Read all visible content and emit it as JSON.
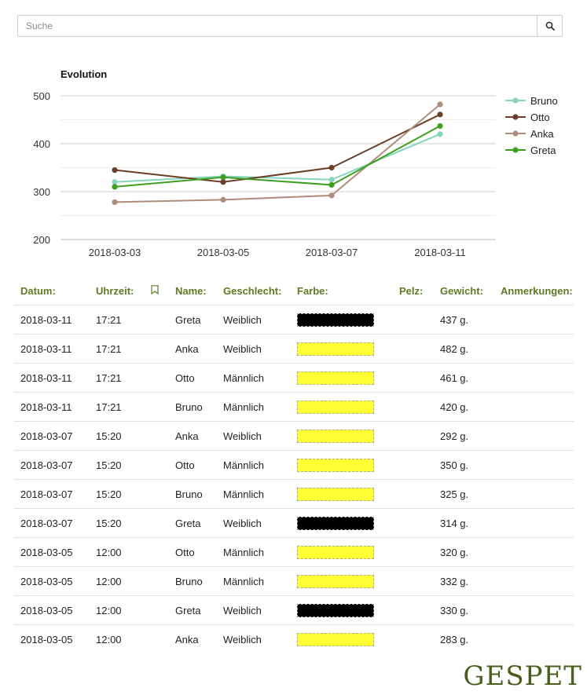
{
  "search": {
    "placeholder": "Suche"
  },
  "chart_data": {
    "type": "line",
    "title": "Evolution",
    "categories": [
      "2018-03-03",
      "2018-03-05",
      "2018-03-07",
      "2018-03-11"
    ],
    "ylim": [
      200,
      500
    ],
    "yticks": [
      200,
      300,
      400,
      500
    ],
    "grid": true,
    "legend": "right",
    "series": [
      {
        "name": "Bruno",
        "color": "#86d6bc",
        "values": [
          320,
          332,
          325,
          420
        ]
      },
      {
        "name": "Otto",
        "color": "#6b3e26",
        "values": [
          345,
          320,
          350,
          461
        ]
      },
      {
        "name": "Anka",
        "color": "#b08d7a",
        "values": [
          278,
          283,
          292,
          482
        ]
      },
      {
        "name": "Greta",
        "color": "#3f9e1f",
        "values": [
          310,
          330,
          314,
          437
        ]
      }
    ]
  },
  "table": {
    "headers": {
      "date": "Datum:",
      "time": "Uhrzeit:",
      "name": "Name:",
      "sex": "Geschlecht:",
      "color": "Farbe:",
      "fur": "Pelz:",
      "weight": "Gewicht:",
      "notes": "Anmerkungen:"
    },
    "rows": [
      {
        "date": "2018-03-11",
        "time": "17:21",
        "name": "Greta",
        "sex": "Weiblich",
        "color": "#000000",
        "fur": "",
        "weight": "437 g.",
        "notes": ""
      },
      {
        "date": "2018-03-11",
        "time": "17:21",
        "name": "Anka",
        "sex": "Weiblich",
        "color": "#ffff33",
        "fur": "",
        "weight": "482 g.",
        "notes": ""
      },
      {
        "date": "2018-03-11",
        "time": "17:21",
        "name": "Otto",
        "sex": "Männlich",
        "color": "#ffff33",
        "fur": "",
        "weight": "461 g.",
        "notes": ""
      },
      {
        "date": "2018-03-11",
        "time": "17:21",
        "name": "Bruno",
        "sex": "Männlich",
        "color": "#ffff33",
        "fur": "",
        "weight": "420 g.",
        "notes": ""
      },
      {
        "date": "2018-03-07",
        "time": "15:20",
        "name": "Anka",
        "sex": "Weiblich",
        "color": "#ffff33",
        "fur": "",
        "weight": "292 g.",
        "notes": ""
      },
      {
        "date": "2018-03-07",
        "time": "15:20",
        "name": "Otto",
        "sex": "Männlich",
        "color": "#ffff33",
        "fur": "",
        "weight": "350 g.",
        "notes": ""
      },
      {
        "date": "2018-03-07",
        "time": "15:20",
        "name": "Bruno",
        "sex": "Männlich",
        "color": "#ffff33",
        "fur": "",
        "weight": "325 g.",
        "notes": ""
      },
      {
        "date": "2018-03-07",
        "time": "15:20",
        "name": "Greta",
        "sex": "Weiblich",
        "color": "#000000",
        "fur": "",
        "weight": "314 g.",
        "notes": ""
      },
      {
        "date": "2018-03-05",
        "time": "12:00",
        "name": "Otto",
        "sex": "Männlich",
        "color": "#ffff33",
        "fur": "",
        "weight": "320 g.",
        "notes": ""
      },
      {
        "date": "2018-03-05",
        "time": "12:00",
        "name": "Bruno",
        "sex": "Männlich",
        "color": "#ffff33",
        "fur": "",
        "weight": "332 g.",
        "notes": ""
      },
      {
        "date": "2018-03-05",
        "time": "12:00",
        "name": "Greta",
        "sex": "Weiblich",
        "color": "#000000",
        "fur": "",
        "weight": "330 g.",
        "notes": ""
      },
      {
        "date": "2018-03-05",
        "time": "12:00",
        "name": "Anka",
        "sex": "Weiblich",
        "color": "#ffff33",
        "fur": "",
        "weight": "283 g.",
        "notes": ""
      }
    ]
  },
  "brand": {
    "logo": "GESPET",
    "accent": "#5e7a22"
  }
}
